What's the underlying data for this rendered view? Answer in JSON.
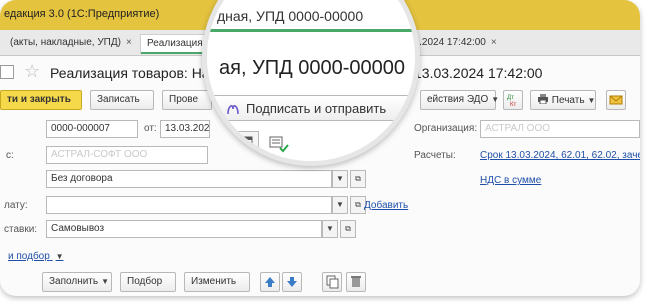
{
  "window": {
    "title": "едакция 3.0  (1С:Предприятие)"
  },
  "tabs": [
    {
      "label": "(акты, накладные, УПД)",
      "close": "×"
    },
    {
      "label": "Реализация товаров",
      "close": ""
    },
    {
      "label": "03.2024 17:42:00",
      "close": "×"
    }
  ],
  "document": {
    "title": "Реализация товаров: На",
    "date_part": "13.03.2024 17:42:00"
  },
  "toolbar": {
    "post_close": "ти и закрыть",
    "save": "Записать",
    "print_left": "Прове",
    "edo": "ействия ЭДО",
    "print": "Печать"
  },
  "form": {
    "number_value": "0000-000007",
    "from_label": "от:",
    "date_value": "13.03.202",
    "org_label": "Организация:",
    "org_value": "АСТРАЛ ООО",
    "counterparty_label": "с:",
    "counterparty_value": "АСТРАЛ-СОФТ ООО",
    "settlements_label": "Расчеты:",
    "settlements_value": "Срок 13.03.2024, 62.01, 62.02, зачет",
    "contract_value": "Без договора",
    "vat_link": "НДС в сумме",
    "payer_label": "лату:",
    "add_link": "Добавить",
    "delivery_label": "ставки:",
    "delivery_value": "Самовывоз",
    "selection_link": "и подбор",
    "table_buttons": {
      "fill": "Заполнить",
      "pick": "Подбор",
      "change": "Изменить"
    }
  },
  "magnifier": {
    "tab_text": "дная, УПД 0000-00000",
    "title": "ая, УПД 0000-00000",
    "sign_button": "Подписать и отправить",
    "date_tail": "00"
  },
  "colors": {
    "title_bar": "#e4c33f",
    "primary_button": "#f6d94b",
    "active_tab_underline": "#4aa86a",
    "link": "#1f4fa8"
  }
}
